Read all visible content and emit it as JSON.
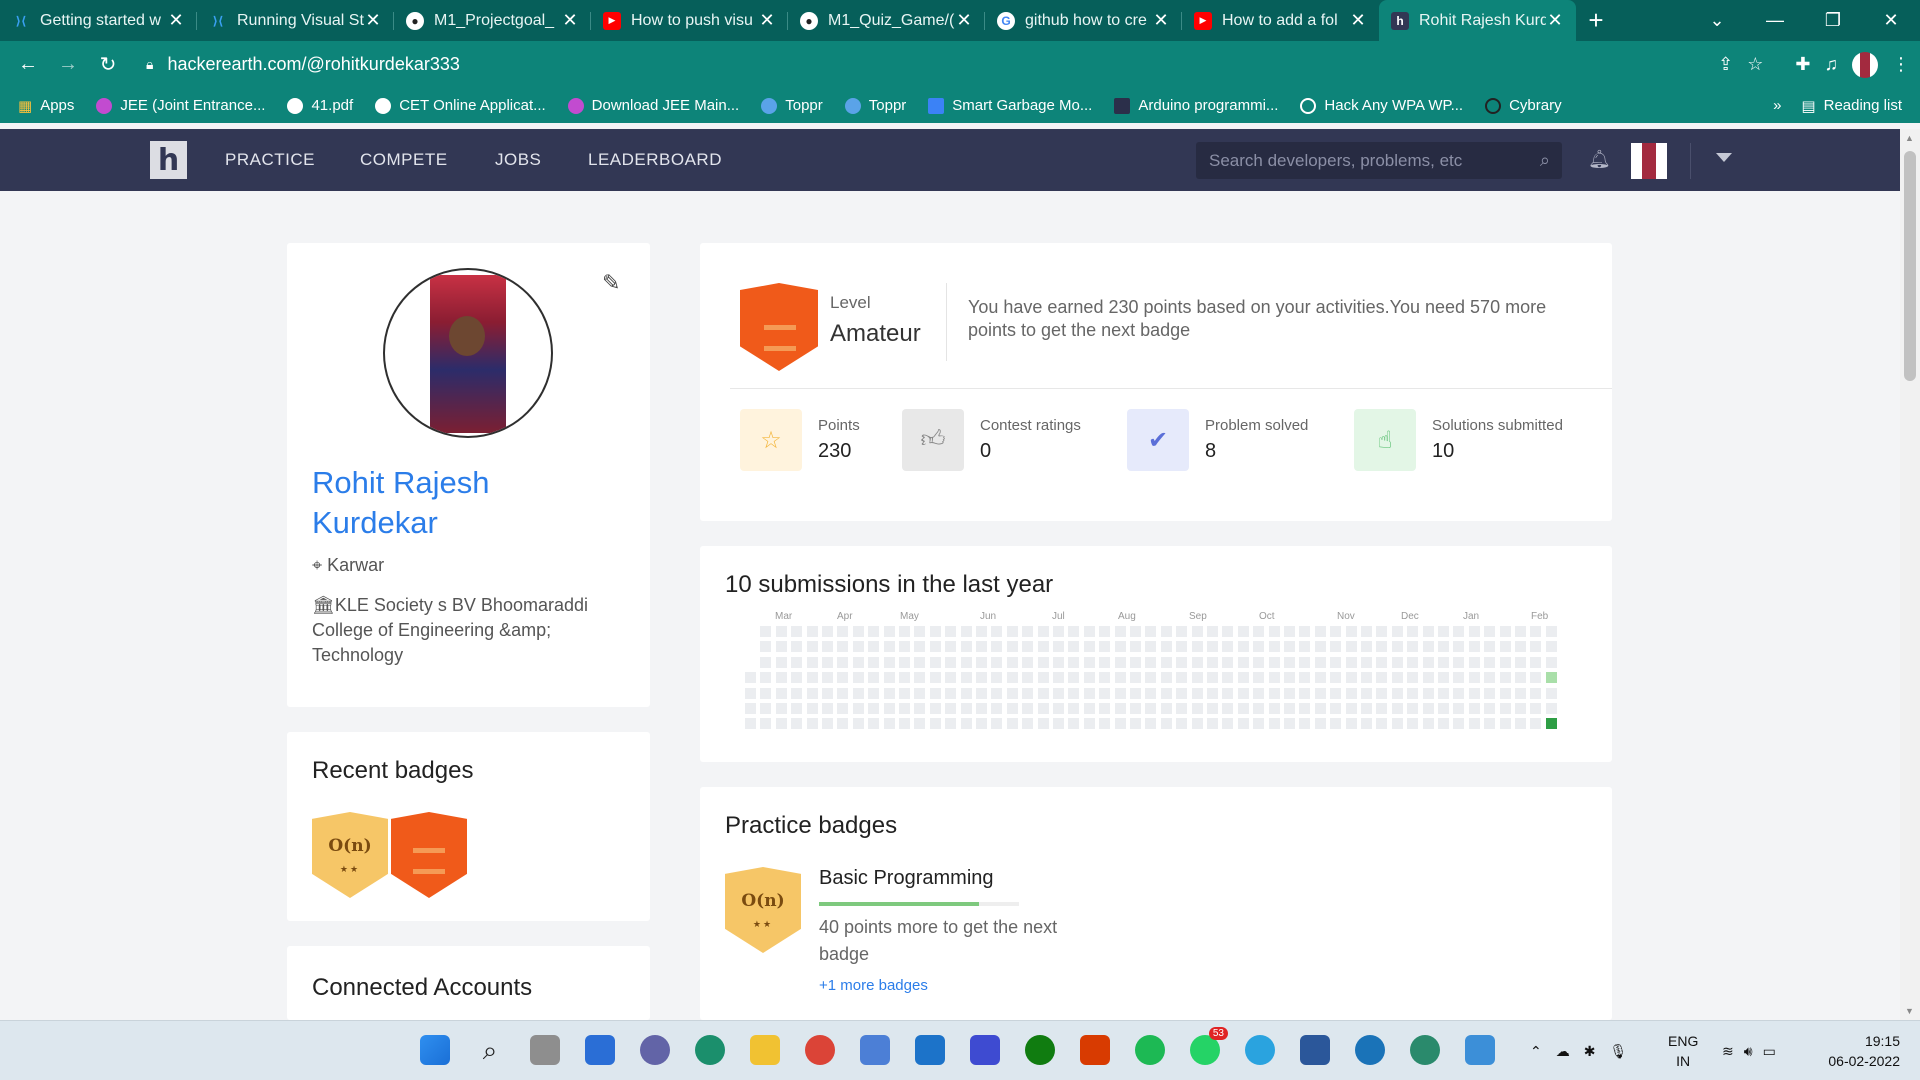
{
  "browser": {
    "tabs": [
      {
        "title": "Getting started w",
        "favicon": "vscode-icon",
        "color": "#3aa0f2"
      },
      {
        "title": "Running Visual St",
        "favicon": "vscode-icon",
        "color": "#3aa0f2"
      },
      {
        "title": "M1_Projectgoal_",
        "favicon": "github-icon",
        "color": "#ffffff"
      },
      {
        "title": "How to push visu",
        "favicon": "youtube-icon",
        "color": "#ff0000"
      },
      {
        "title": "M1_Quiz_Game/(",
        "favicon": "github-icon",
        "color": "#ffffff"
      },
      {
        "title": "github how to cre",
        "favicon": "google-icon",
        "color": "#ffffff"
      },
      {
        "title": "How to add a fol",
        "favicon": "youtube-icon",
        "color": "#ff0000"
      },
      {
        "title": "Rohit Rajesh Kurd",
        "favicon": "hackerearth-icon",
        "color": "#323754",
        "active": true
      }
    ],
    "url": "hackerearth.com/@rohitkurdekar333",
    "bookmarks": [
      {
        "label": "Apps"
      },
      {
        "label": "JEE (Joint Entrance..."
      },
      {
        "label": "41.pdf"
      },
      {
        "label": "CET Online Applicat..."
      },
      {
        "label": "Download JEE Main..."
      },
      {
        "label": "Toppr"
      },
      {
        "label": "Toppr"
      },
      {
        "label": "Smart Garbage Mo..."
      },
      {
        "label": "Arduino programmi..."
      },
      {
        "label": "Hack Any WPA WP..."
      },
      {
        "label": "Cybrary"
      }
    ],
    "bookmarks_more": "»",
    "reading_list": "Reading list"
  },
  "site_nav": {
    "logo": "h",
    "links": [
      "PRACTICE",
      "COMPETE",
      "JOBS",
      "LEADERBOARD"
    ],
    "search_placeholder": "Search developers, problems, etc"
  },
  "profile": {
    "name": "Rohit Rajesh Kurdekar",
    "location": "Karwar",
    "college": "KLE Society s BV Bhoomaraddi College of Engineering &amp; Technology"
  },
  "recent_badges": {
    "title": "Recent badges",
    "badge_text": "O(n)",
    "stars": "★★"
  },
  "connected": {
    "title": "Connected Accounts"
  },
  "level": {
    "label": "Level",
    "name": "Amateur",
    "description": "You have earned 230 points based on your activities.You need 570 more points to get the next badge"
  },
  "stats": [
    {
      "label": "Points",
      "value": "230",
      "icon": "star-icon",
      "bg": "#fff3dd",
      "fg": "#f3b63c"
    },
    {
      "label": "Contest ratings",
      "value": "0",
      "icon": "thumbs-up-icon",
      "bg": "#e8e8e8",
      "fg": "#888888"
    },
    {
      "label": "Problem solved",
      "value": "8",
      "icon": "check-circle-icon",
      "bg": "#e6eafb",
      "fg": "#5b6fd8"
    },
    {
      "label": "Solutions submitted",
      "value": "10",
      "icon": "pointer-hand-icon",
      "bg": "#e3f6e6",
      "fg": "#48b962"
    }
  ],
  "submissions": {
    "title": "10 submissions in the last year",
    "months": [
      "Mar",
      "Apr",
      "May",
      "Jun",
      "Jul",
      "Aug",
      "Sep",
      "Oct",
      "Nov",
      "Dec",
      "Jan",
      "Feb"
    ],
    "active_cells": [
      {
        "week": 52,
        "day": 3,
        "level": 1
      },
      {
        "week": 52,
        "day": 6,
        "level": 3
      }
    ],
    "colors": {
      "empty": "#ebedf0",
      "l1": "#a9dfa9",
      "l3": "#2e9e45"
    }
  },
  "practice_badges": {
    "title": "Practice badges",
    "badge_text": "O(n)",
    "stars": "★★",
    "name": "Basic Programming",
    "progress": 0.8,
    "text": "40 points more to get the next badge",
    "more": "+1 more badges"
  },
  "taskbar": {
    "whatsapp_count": "53",
    "lang": "ENG",
    "region": "IN",
    "time": "19:15",
    "date": "06-02-2022"
  }
}
